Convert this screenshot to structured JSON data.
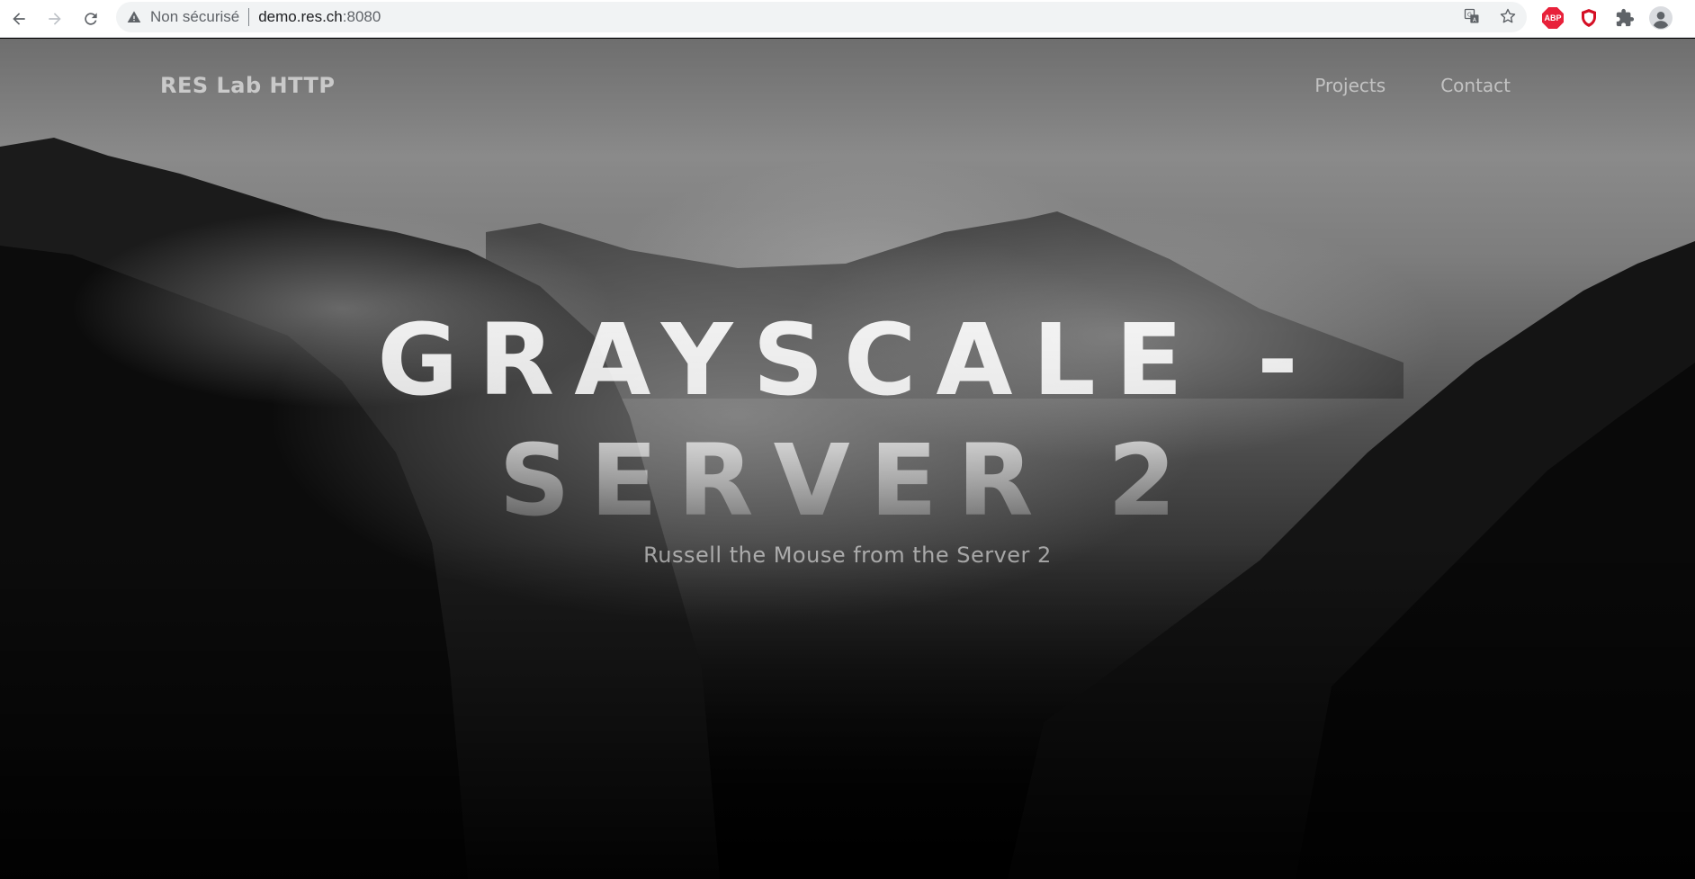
{
  "browser": {
    "security_label": "Non sécurisé",
    "url_host": "demo.res.ch",
    "url_port": ":8080",
    "icons": [
      "back-icon",
      "forward-icon",
      "reload-icon",
      "warning-icon",
      "translate-icon",
      "bookmark-star-icon",
      "adblock-plus-icon",
      "shield-extension-icon",
      "extensions-puzzle-icon",
      "profile-avatar-icon"
    ],
    "adblock_badge": "ABP"
  },
  "site": {
    "brand": "RES Lab HTTP",
    "nav": [
      {
        "label": "Projects"
      },
      {
        "label": "Contact"
      }
    ],
    "headline_line1": "GRAYSCALE -",
    "headline_line2": "SERVER 2",
    "subtitle": "Russell the Mouse from the Server 2"
  },
  "colors": {
    "adblock": "#e8213a",
    "shield": "#d50f25"
  }
}
